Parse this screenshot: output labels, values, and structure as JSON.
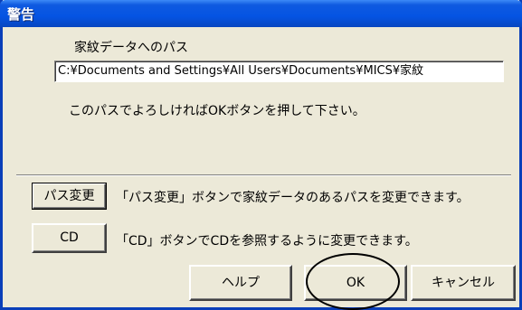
{
  "window": {
    "title": "警告"
  },
  "path": {
    "caption": "家紋データへのパス",
    "value": "C:¥Documents and Settings¥All Users¥Documents¥MICS¥家紋",
    "instruction": "このパスでよろしければOKボタンを押して下さい。"
  },
  "options": {
    "change_path_button": "パス変更",
    "change_path_desc": "「パス変更」ボタンで家紋データのあるパスを変更できます。",
    "cd_button": "CD",
    "cd_desc": "「CD」ボタンでCDを参照するように変更できます。"
  },
  "footer": {
    "help_button": "ヘルプ",
    "ok_button": "OK",
    "cancel_button": "キャンセル"
  }
}
